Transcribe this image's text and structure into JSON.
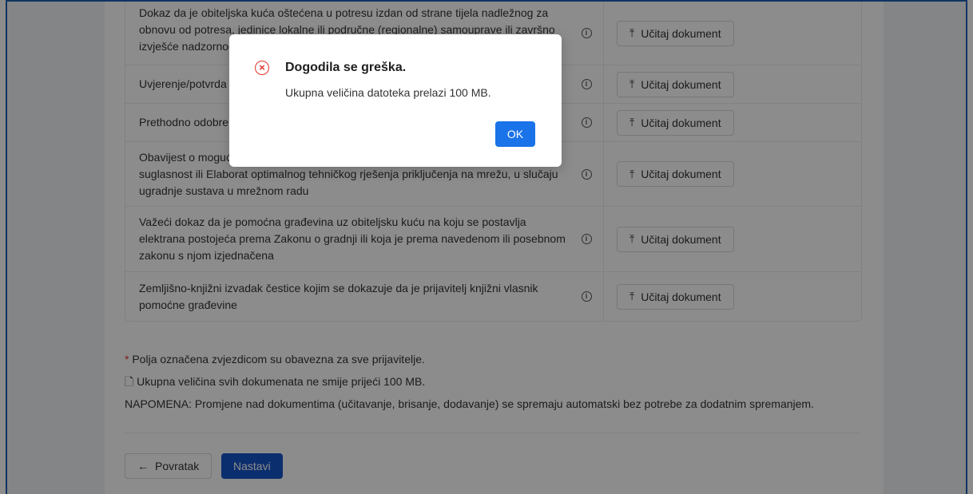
{
  "documents": [
    {
      "text": "Dokaz da je obiteljska kuća oštećena u potresu izdan od strane tijela nadležnog za obnovu od potresa, jedinice lokalne ili područne (regionalne) samouprave ili završno izvješće nadzornog inženjera",
      "upload_label": "Učitaj dokument"
    },
    {
      "text": "Uvjerenje/potvrda o",
      "upload_label": "Učitaj dokument"
    },
    {
      "text": "Prethodno odobrenje",
      "upload_label": "Učitaj dokument"
    },
    {
      "text": "Obavijest o mogućnosti priključenja na elektroenergetsku mrežu, Elektroenergetska suglasnost ili Elaborat optimalnog tehničkog rješenja priključenja na mrežu, u slučaju ugradnje sustava u mrežnom radu",
      "upload_label": "Učitaj dokument"
    },
    {
      "text": "Važeći dokaz da je pomoćna građevina uz obiteljsku kuću na koju se postavlja elektrana postojeća prema Zakonu o gradnji ili koja je prema navedenom ili posebnom zakonu s njom izjednačena",
      "upload_label": "Učitaj dokument"
    },
    {
      "text": "Zemljišno-knjižni izvadak čestice kojim se dokazuje da je prijavitelj knjižni vlasnik pomoćne građevine",
      "upload_label": "Učitaj dokument"
    }
  ],
  "notes": {
    "star": "*",
    "required": "Polja označena zvjezdicom su obavezna za sve prijavitelje.",
    "size_limit": "Ukupna veličina svih dokumenata ne smije prijeći 100 MB.",
    "napomena": "NAPOMENA: Promjene nad dokumentima (učitavanje, brisanje, dodavanje) se spremaju automatski bez potrebe za dodatnim spremanjem."
  },
  "nav": {
    "back_label": "Povratak",
    "next_label": "Nastavi"
  },
  "modal": {
    "title": "Dogodila se greška.",
    "message": "Ukupna veličina datoteka prelazi 100 MB.",
    "ok_label": "OK",
    "icon": "error-circle-icon"
  },
  "colors": {
    "primary": "#1554c8",
    "error": "#e0342c",
    "ok": "#1a73e8"
  }
}
